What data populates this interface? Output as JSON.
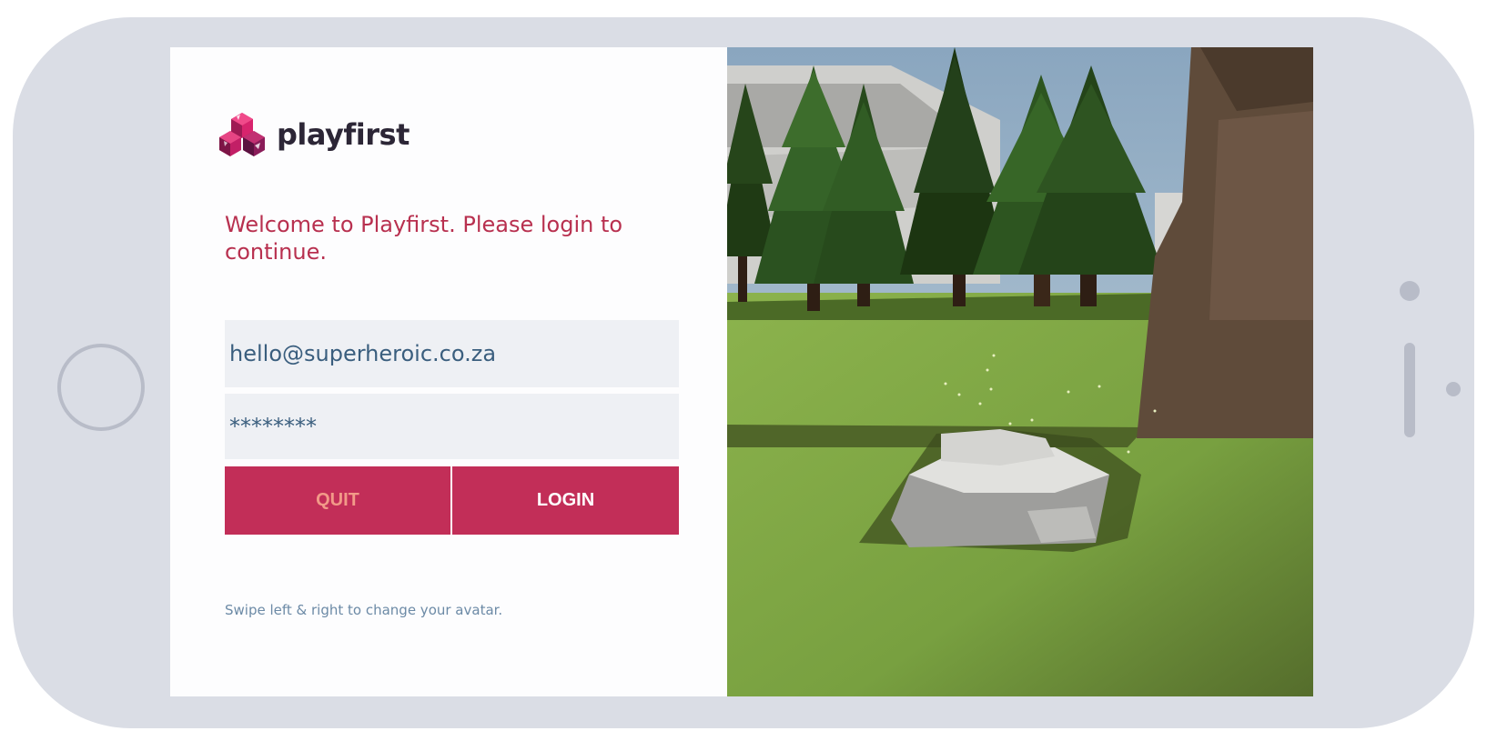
{
  "brand": {
    "name": "playfirst",
    "logo_icon": "playfirst-cube-logo"
  },
  "login": {
    "welcome_text": "Welcome to Playfirst. Please login to continue.",
    "email_value": "hello@superheroic.co.za",
    "password_value": "********",
    "quit_label": "QUIT",
    "login_label": "LOGIN",
    "hint": "Swipe left & right to change your avatar."
  },
  "colors": {
    "accent": "#c22e58",
    "welcome_text": "#b8304f",
    "field_bg": "#eef0f4",
    "field_text": "#3a5e7e",
    "hint_text": "#6c8aa6",
    "quit_text": "#f29a88"
  },
  "device": {
    "frame": "phone-landscape",
    "home_button": "home-button-icon"
  }
}
